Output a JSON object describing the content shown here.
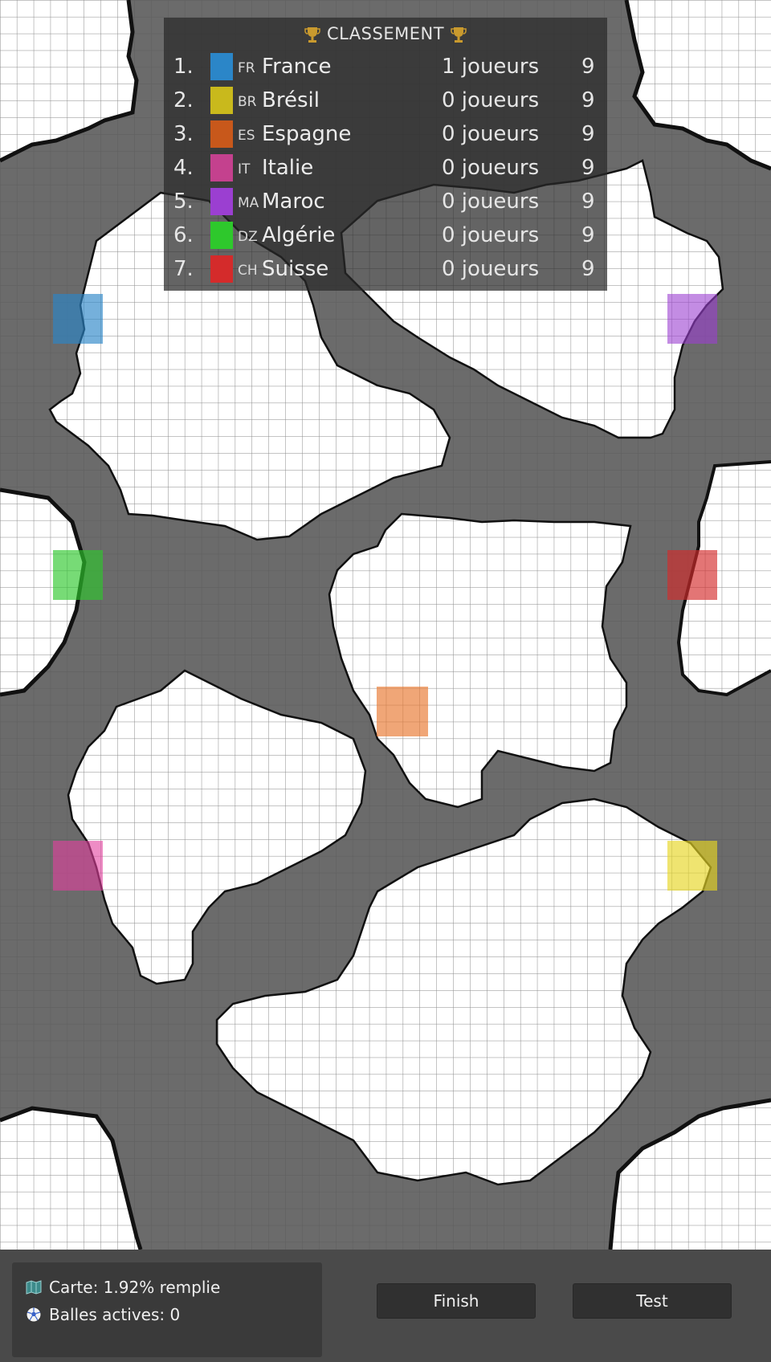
{
  "leaderboard": {
    "title": "CLASSEMENT",
    "rows": [
      {
        "rank": "1.",
        "code": "FR",
        "name": "France",
        "players": "1 joueurs",
        "score": "9",
        "color": "#2b86c8"
      },
      {
        "rank": "2.",
        "code": "BR",
        "name": "Brésil",
        "players": "0 joueurs",
        "score": "9",
        "color": "#c9b91c"
      },
      {
        "rank": "3.",
        "code": "ES",
        "name": "Espagne",
        "players": "0 joueurs",
        "score": "9",
        "color": "#c8581b"
      },
      {
        "rank": "4.",
        "code": "IT",
        "name": "Italie",
        "players": "0 joueurs",
        "score": "9",
        "color": "#c4418e"
      },
      {
        "rank": "5.",
        "code": "MA",
        "name": "Maroc",
        "players": "0 joueurs",
        "score": "9",
        "color": "#9b3fd1"
      },
      {
        "rank": "6.",
        "code": "DZ",
        "name": "Algérie",
        "players": "0 joueurs",
        "score": "9",
        "color": "#2ec82c"
      },
      {
        "rank": "7.",
        "code": "CH",
        "name": "Suisse",
        "players": "0 joueurs",
        "score": "9",
        "color": "#d42b2b"
      }
    ]
  },
  "info": {
    "map_fill": "Carte: 1.92% remplie",
    "active_balls": "Balles actives: 0"
  },
  "buttons": {
    "finish": "Finish",
    "test": "Test"
  },
  "colors": {
    "water": "#6b6b6b",
    "land": "#ffffff",
    "grid_line": "#7a7a7a",
    "bar": "#4a4a4a",
    "panel": "#3a3a3a"
  },
  "icons": {
    "trophy": "trophy-icon",
    "map": "map-icon",
    "ball": "soccer-ball-icon"
  }
}
